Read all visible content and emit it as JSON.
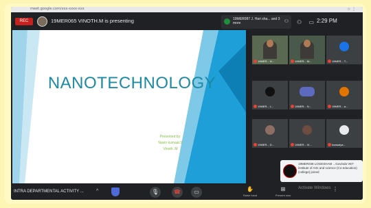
{
  "browser": {
    "url": "meet.google.com/xxx-xxxx-xxx",
    "icons": "☆ ⋮"
  },
  "topbar": {
    "rec_label": "REC",
    "presenting_text": "19MER065 VINOTH.M is presenting",
    "notification": "19MER087 J. Hari sha... and 3 more",
    "clock": "2:29 PM",
    "icons": "⚇ ▭"
  },
  "slide": {
    "title": "NANOTECHNOLOGY",
    "presented_by": "Presented by:",
    "presenter_1": "Navin kumaar.S",
    "presenter_2": "Vinoth .M"
  },
  "gallery": {
    "tiles": [
      {
        "name": "19MER... N...",
        "video": true
      },
      {
        "name": "19MER... M...",
        "video": true
      },
      {
        "name": "19MER... T...",
        "video": false
      },
      {
        "name": "19MER... L...",
        "video": false
      },
      {
        "name": "19MER... N...",
        "video": false
      },
      {
        "name": "19MER... a...",
        "video": false
      },
      {
        "name": "19MER... D...",
        "video": false
      },
      {
        "name": "19MER... Vi...",
        "video": false
      },
      {
        "name": "kowsalya...",
        "video": false
      }
    ],
    "tile_colors": [
      "#5a6a52",
      "#4a5a4a",
      "#1a73e8",
      "#202124",
      "#3c4043",
      "#e37400",
      "#8d6e63",
      "#6d4c41",
      "#e8eaed"
    ]
  },
  "popup": {
    "text": "19MER038 LOGESHAM ...Govinda VET institute of Arts and science (Co-education) (college) joined"
  },
  "bottombar": {
    "meeting_name": "INTRA DEPARTMENTAL ACTIVITY ...",
    "mic_icon": "🎙",
    "end_icon": "☎",
    "camera_icon": "▭",
    "raise_hand_label": "Raise hand",
    "present_label": "Present now",
    "watermark": "Activate Windows"
  }
}
